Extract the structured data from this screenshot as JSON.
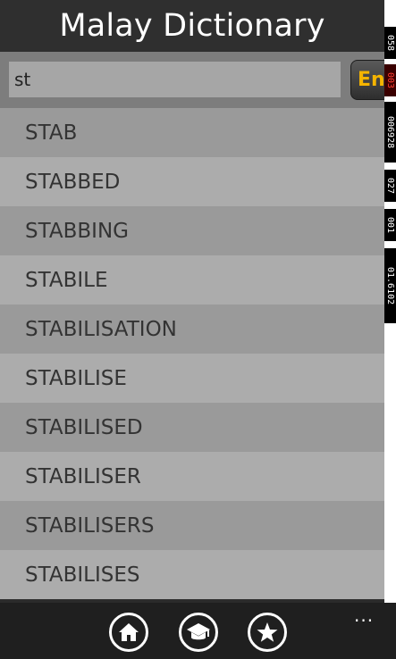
{
  "app": {
    "title": "Malay Dictionary"
  },
  "search": {
    "value": "st",
    "language_button": "En"
  },
  "word_list": [
    "STAB",
    "STABBED",
    "STABBING",
    "STABILE",
    "STABILISATION",
    "STABILISE",
    "STABILISED",
    "STABILISER",
    "STABILISERS",
    "STABILISES"
  ],
  "stamp": {
    "segments": [
      "058",
      "003",
      "006928",
      "027",
      "001",
      "01.6102"
    ]
  },
  "appbar": {
    "icons": [
      "home-icon",
      "graduation-cap-icon",
      "star-icon"
    ],
    "more_label": "..."
  },
  "colors": {
    "accent": "#f5b400",
    "list_odd": "#9a9a9a",
    "list_even": "#acacac"
  }
}
